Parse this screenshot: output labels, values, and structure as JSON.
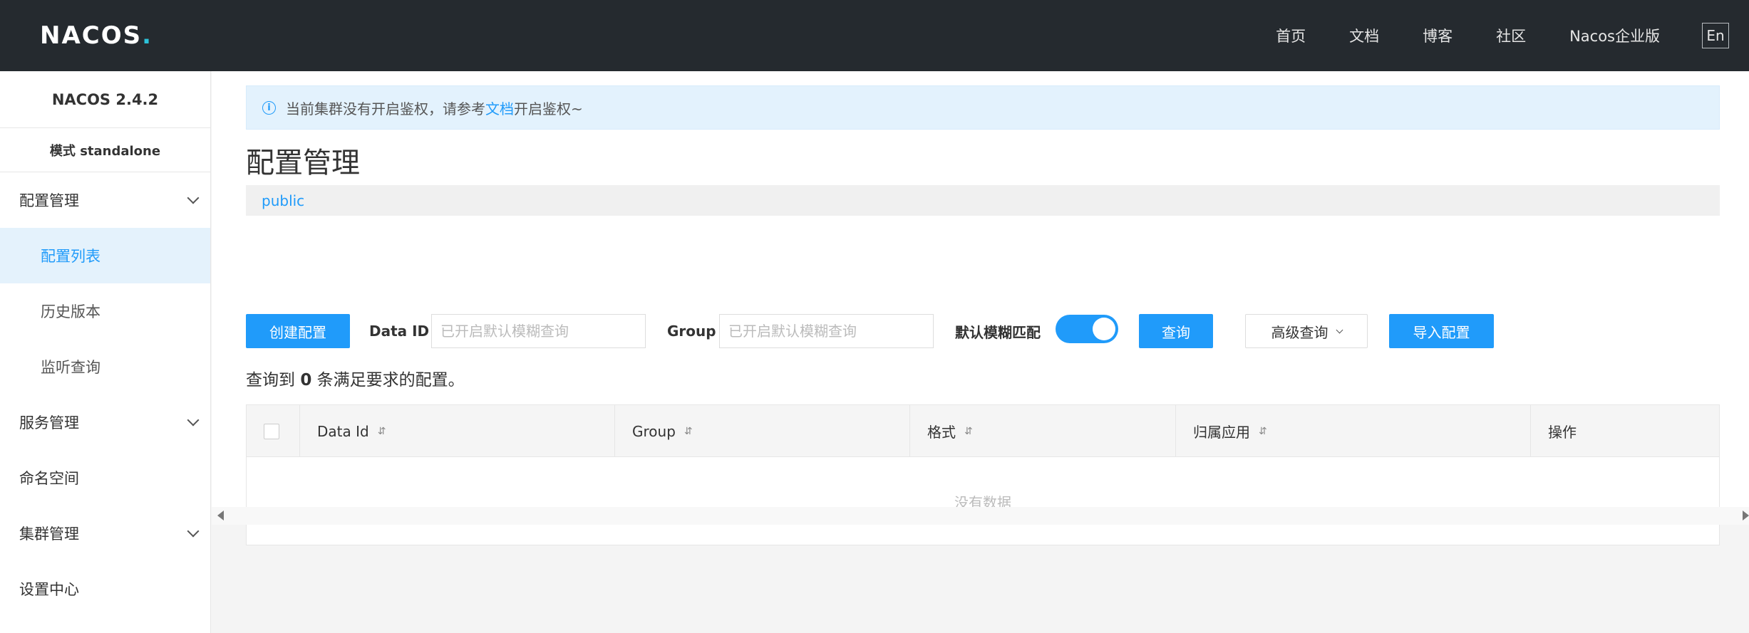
{
  "header": {
    "logo_text": "NACOS",
    "nav": [
      "首页",
      "文档",
      "博客",
      "社区",
      "Nacos企业版"
    ],
    "lang_button": "En"
  },
  "sidebar": {
    "version": "NACOS 2.4.2",
    "mode": "模式 standalone",
    "items": [
      {
        "label": "配置管理",
        "type": "group",
        "expanded": true
      },
      {
        "label": "配置列表",
        "type": "sub",
        "active": true
      },
      {
        "label": "历史版本",
        "type": "sub"
      },
      {
        "label": "监听查询",
        "type": "sub"
      },
      {
        "label": "服务管理",
        "type": "group"
      },
      {
        "label": "命名空间",
        "type": "leaf"
      },
      {
        "label": "集群管理",
        "type": "group"
      },
      {
        "label": "设置中心",
        "type": "leaf"
      }
    ]
  },
  "notice": {
    "prefix": "当前集群没有开启鉴权，请参考",
    "link": "文档",
    "suffix": "开启鉴权~"
  },
  "page": {
    "title": "配置管理",
    "namespace": "public"
  },
  "toolbar": {
    "create_button": "创建配置",
    "data_id_label": "Data ID",
    "data_id_placeholder": "已开启默认模糊查询",
    "group_label": "Group",
    "group_placeholder": "已开启默认模糊查询",
    "fuzzy_label": "默认模糊匹配",
    "fuzzy_enabled": true,
    "query_button": "查询",
    "advanced_button": "高级查询",
    "import_button": "导入配置"
  },
  "result": {
    "prefix": "查询到",
    "count": "0",
    "suffix": "条满足要求的配置。"
  },
  "table": {
    "columns": [
      "Data Id",
      "Group",
      "格式",
      "归属应用",
      "操作"
    ],
    "sort_icon": "⇵",
    "empty_text": "没有数据"
  },
  "colors": {
    "primary": "#209bfa",
    "header_bg": "#252a2f",
    "accent": "#2cc2d9"
  }
}
